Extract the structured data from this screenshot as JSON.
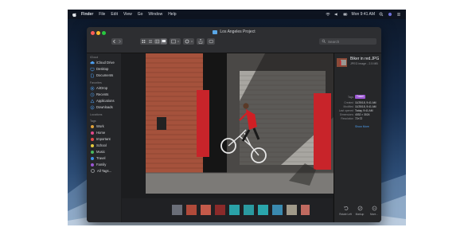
{
  "menubar": {
    "app_name": "Finder",
    "items": [
      "File",
      "Edit",
      "View",
      "Go",
      "Window",
      "Help"
    ],
    "clock": "Mon 9:41 AM"
  },
  "window": {
    "title": "Los Angeles Project",
    "search_placeholder": "Search"
  },
  "sidebar": {
    "sections": {
      "icloud": "iCloud",
      "favorites": "Favorites",
      "locations": "Locations",
      "tags": "Tags"
    },
    "icloud_items": [
      "iCloud Drive",
      "Desktop",
      "Documents"
    ],
    "favorite_items": [
      "AirDrop",
      "Recents",
      "Applications",
      "Downloads"
    ],
    "tag_items": [
      {
        "label": "Work",
        "color": "#e0a23a"
      },
      {
        "label": "Home",
        "color": "#e04a8a"
      },
      {
        "label": "Important",
        "color": "#e24848"
      },
      {
        "label": "School",
        "color": "#e3c93d"
      },
      {
        "label": "Music",
        "color": "#49b95d"
      },
      {
        "label": "Travel",
        "color": "#3e8fe0"
      },
      {
        "label": "Family",
        "color": "#9c56d4"
      },
      {
        "label": "All Tags...",
        "color": "#8a8c90"
      }
    ]
  },
  "actions": [
    "Rotate Left",
    "Markup",
    "More..."
  ],
  "inspector": {
    "file_name": "Biker in red.JPG",
    "kind": "JPEG image - 2.5 MB",
    "tags_label": "Tags",
    "tag_value": "Travel",
    "rows": [
      {
        "k": "Created",
        "v": "11/25/18, 9:41 AM"
      },
      {
        "k": "Modified",
        "v": "11/25/18, 9:41 AM"
      },
      {
        "k": "Last opened",
        "v": "Today, 9:41 AM"
      },
      {
        "k": "Dimensions",
        "v": "4032 × 3024"
      },
      {
        "k": "Resolution",
        "v": "72×72"
      }
    ],
    "show_more": "Show More"
  },
  "colors": {
    "accent": "#4d9ff0",
    "tag_travel": "#9c56d4",
    "brick": "#a5523c",
    "red_post": "#c8242a"
  }
}
